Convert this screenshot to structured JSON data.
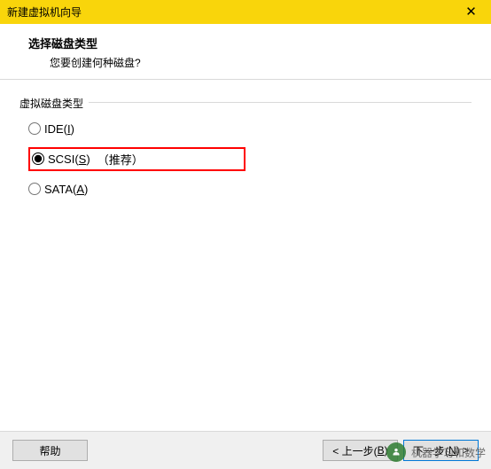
{
  "title": "新建虚拟机向导",
  "header": {
    "title": "选择磁盘类型",
    "subtitle": "您要创建何种磁盘?"
  },
  "fieldset": {
    "legend": "虚拟磁盘类型",
    "options": {
      "ide": {
        "label": "IDE(",
        "hotkey": "I",
        "tail": ")",
        "checked": false
      },
      "scsi": {
        "label": "SCSI(",
        "hotkey": "S",
        "tail": ")",
        "suffix": "（推荐）",
        "checked": true
      },
      "sata": {
        "label": "SATA(",
        "hotkey": "A",
        "tail": ")",
        "checked": false
      }
    }
  },
  "footer": {
    "help": "帮助",
    "back": {
      "pre": "< 上一步(",
      "hotkey": "B",
      "tail": ")"
    },
    "next": {
      "pre": "下一步(",
      "hotkey": "N",
      "tail": ") >"
    }
  },
  "watermark": {
    "text": "机器学习和数学"
  }
}
